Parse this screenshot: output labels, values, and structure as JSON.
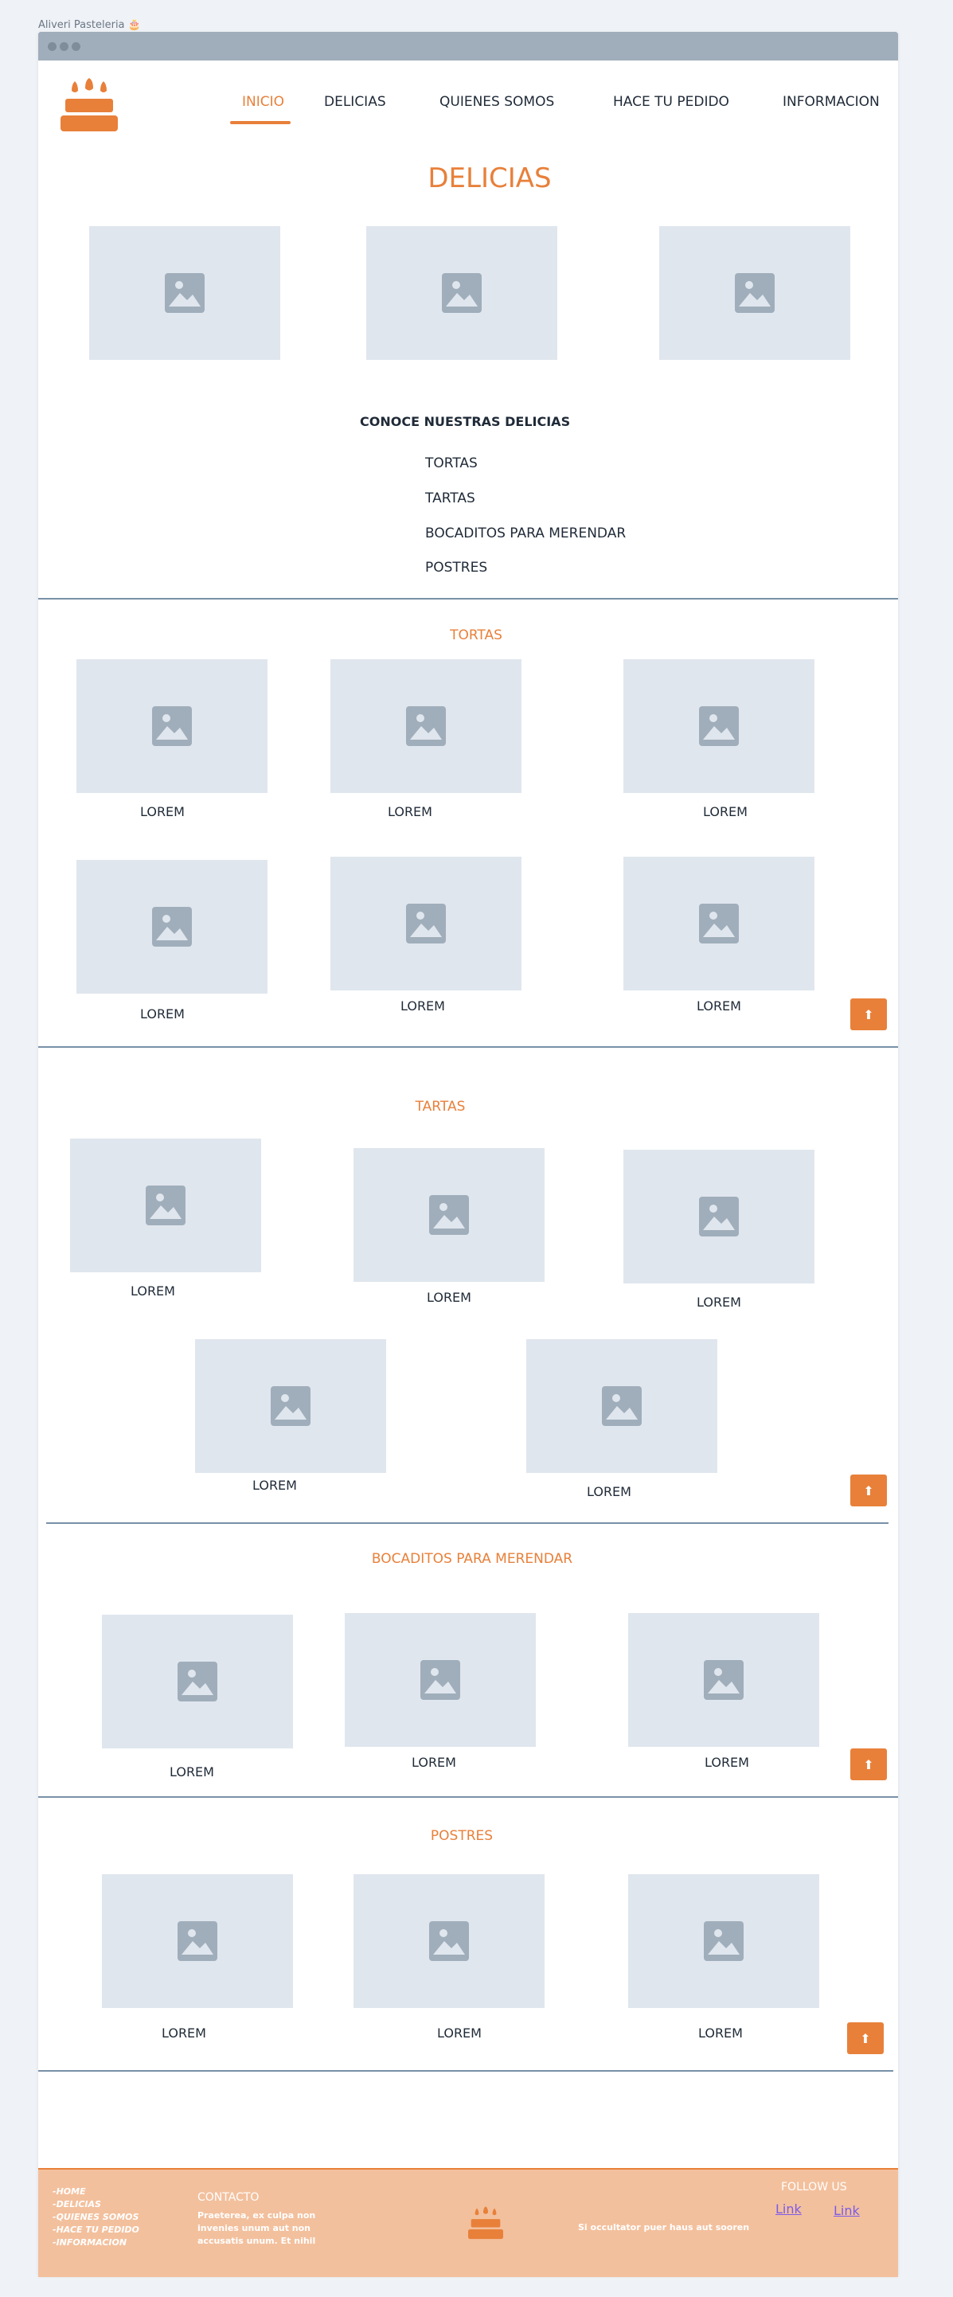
{
  "app": {
    "title": "Aliveri Pasteleria",
    "title_emoji": "🎂"
  },
  "nav": {
    "items": [
      "INICIO",
      "DELICIAS",
      "QUIENES SOMOS",
      "HACE TU PEDIDO",
      "INFORMACION"
    ],
    "active": "INICIO"
  },
  "main": {
    "title": "DELICIAS"
  },
  "conoce": {
    "title": "CONOCE NUESTRAS DELICIAS",
    "links": [
      "TORTAS",
      "TARTAS",
      "BOCADITOS PARA MERENDAR",
      "POSTRES"
    ]
  },
  "sections": {
    "tortas": {
      "title": "TORTAS",
      "captions": [
        "LOREM",
        "LOREM",
        "LOREM",
        "LOREM",
        "LOREM",
        "LOREM"
      ]
    },
    "tartas": {
      "title": "TARTAS",
      "captions": [
        "LOREM",
        "LOREM",
        "LOREM",
        "LOREM",
        "LOREM"
      ]
    },
    "bocaditos": {
      "title": "BOCADITOS PARA MERENDAR",
      "captions": [
        "LOREM",
        "LOREM",
        "LOREM"
      ]
    },
    "postres": {
      "title": "POSTRES",
      "captions": [
        "LOREM",
        "LOREM",
        "LOREM"
      ]
    }
  },
  "back_to_top": {
    "icon": "arrow-up-icon",
    "glyph": "⬆"
  },
  "footer": {
    "nav_items": [
      "-HOME",
      "-DELICIAS",
      "-QUIENES SOMOS",
      "-HACE TU PEDIDO",
      "-INFORMACION"
    ],
    "contact_title": "CONTACTO",
    "contact_lines": [
      "Praeterea, ex culpa non",
      "invenies unum aut non",
      "accusatis unum. Et nihil"
    ],
    "tagline": "Si occultator puer haus aut sooren",
    "follow_title": "FOLLOW US",
    "links": [
      "Link",
      "Link"
    ]
  },
  "colors": {
    "accent": "#e8803a",
    "placeholder": "#e0e6ee",
    "placeholder_icon": "#a0aebb",
    "footer_bg": "#f3c09d",
    "divider": "#7891a7"
  }
}
